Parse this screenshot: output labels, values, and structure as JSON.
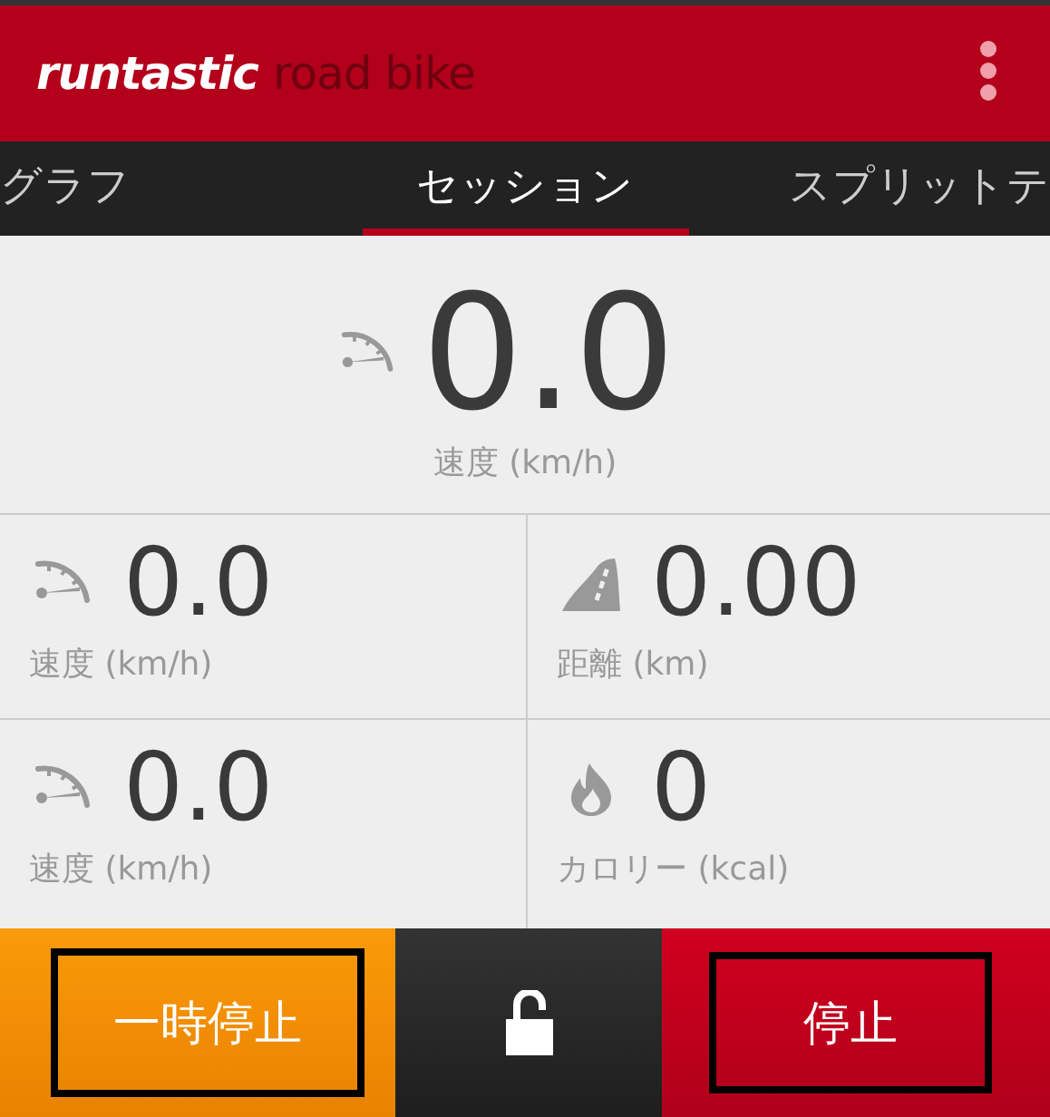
{
  "app_bar": {
    "logo_primary": "runtastic",
    "logo_secondary": "road bike"
  },
  "tabs": [
    {
      "label": "グラフ",
      "selected": false
    },
    {
      "label": "セッション",
      "selected": true
    },
    {
      "label": "スプリットテ",
      "selected": false
    }
  ],
  "hero_metric": {
    "kind": "speed",
    "value": "0.0",
    "label": "速度 (km/h)"
  },
  "metrics": [
    {
      "kind": "speed",
      "value": "0.0",
      "label": "速度 (km/h)"
    },
    {
      "kind": "distance",
      "value": "0.00",
      "label": "距離 (km)"
    },
    {
      "kind": "speed",
      "value": "0.0",
      "label": "速度 (km/h)"
    },
    {
      "kind": "calories",
      "value": "0",
      "label": "カロリー (kcal)"
    }
  ],
  "controls": {
    "pause": "一時停止",
    "locked": false,
    "stop": "停止"
  }
}
